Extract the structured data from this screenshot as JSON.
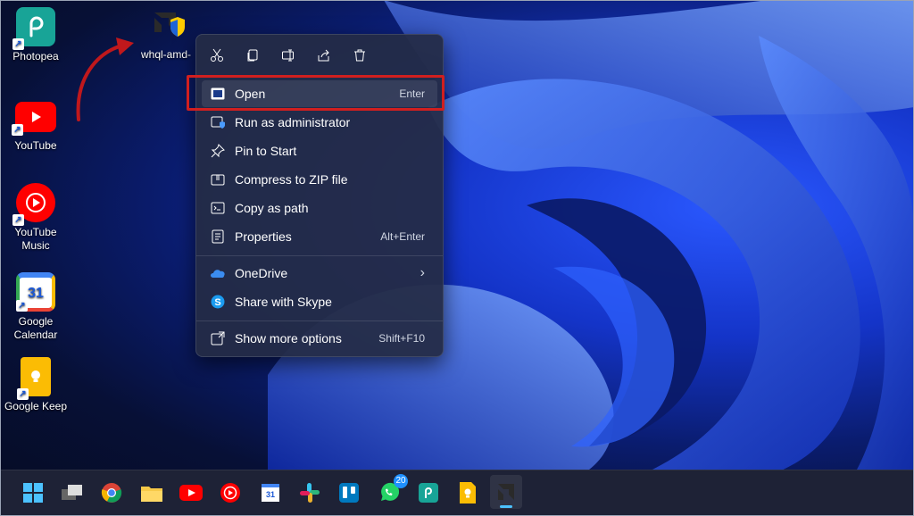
{
  "desktop_icons": [
    {
      "label": "Photopea",
      "icon": "photopea-icon"
    },
    {
      "label": "YouTube",
      "icon": "youtube-icon"
    },
    {
      "label": "YouTube\nMusic",
      "icon": "youtube-music-icon"
    },
    {
      "label": "Google\nCalendar",
      "icon": "google-calendar-icon",
      "day": "31"
    },
    {
      "label": "Google Keep",
      "icon": "google-keep-icon"
    }
  ],
  "file_icon": {
    "label": "whql-amd-"
  },
  "context_menu": {
    "toolbar": [
      "cut-icon",
      "copy-icon",
      "rename-icon",
      "share-icon",
      "delete-icon"
    ],
    "items": [
      {
        "label": "Open",
        "shortcut": "Enter",
        "icon": "open-icon"
      },
      {
        "label": "Run as administrator",
        "shortcut": "",
        "icon": "shield-icon"
      },
      {
        "label": "Pin to Start",
        "shortcut": "",
        "icon": "pin-icon"
      },
      {
        "label": "Compress to ZIP file",
        "shortcut": "",
        "icon": "zip-icon"
      },
      {
        "label": "Copy as path",
        "shortcut": "",
        "icon": "copy-path-icon"
      },
      {
        "label": "Properties",
        "shortcut": "Alt+Enter",
        "icon": "properties-icon"
      },
      {
        "label": "OneDrive",
        "shortcut": "›",
        "icon": "onedrive-icon"
      },
      {
        "label": "Share with Skype",
        "shortcut": "",
        "icon": "skype-icon"
      },
      {
        "label": "Show more options",
        "shortcut": "Shift+F10",
        "icon": "more-options-icon"
      }
    ]
  },
  "taskbar": {
    "apps": [
      "start-icon",
      "task-view-icon",
      "chrome-icon",
      "file-explorer-icon",
      "youtube-icon",
      "youtube-music-icon",
      "google-calendar-icon",
      "slack-icon",
      "trello-icon",
      "whatsapp-icon",
      "photopea-icon",
      "google-keep-icon",
      "amd-installer-icon"
    ],
    "calendar_day": "31",
    "whatsapp_badge": "20"
  },
  "colors": {
    "highlight": "#d11f1f",
    "arrow": "#c0181c",
    "accent": "#2a58ff"
  }
}
